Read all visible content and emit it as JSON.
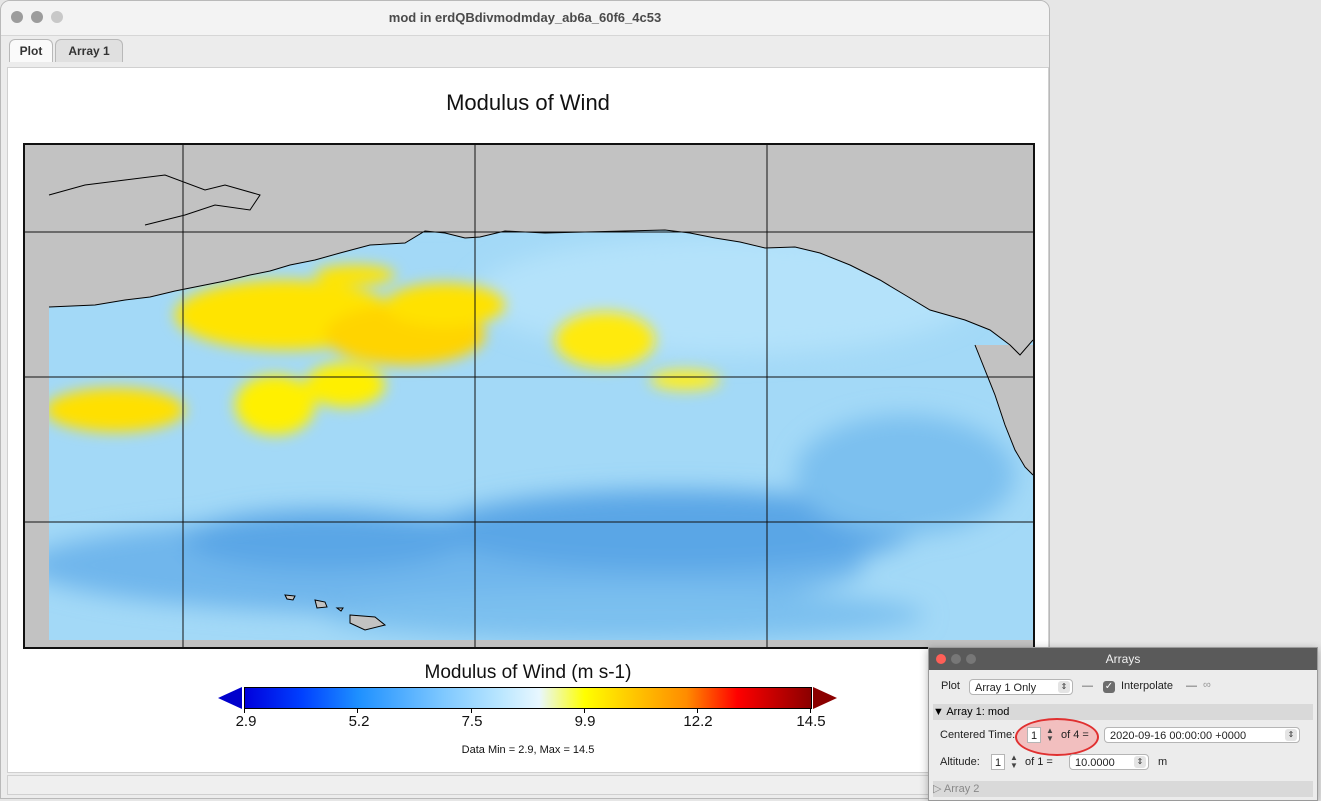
{
  "window": {
    "title": "mod in erdQBdivmodmday_ab6a_60f6_4c53"
  },
  "tabs": [
    {
      "label": "Plot",
      "active": true
    },
    {
      "label": "Array 1",
      "active": false
    }
  ],
  "plot": {
    "title": "Modulus of Wind",
    "colorbar": {
      "title": "Modulus of Wind (m s-1)",
      "ticks": [
        "2.9",
        "5.2",
        "7.5",
        "9.9",
        "12.2",
        "14.5"
      ],
      "min_color": "#0000cc",
      "max_color": "#8b0000"
    },
    "data_range": "Data Min = 2.9, Max = 14.5"
  },
  "arrays_panel": {
    "title": "Arrays",
    "plot_label": "Plot",
    "plot_select": "Array 1 Only",
    "interpolate_label": "Interpolate",
    "interpolate_checked": true,
    "array1_header": "Array 1: mod",
    "centered_time_label": "Centered Time:",
    "centered_time_index": "1",
    "centered_time_of": "of 4 =",
    "centered_time_value": "2020-09-16 00:00:00 +0000",
    "altitude_label": "Altitude:",
    "altitude_index": "1",
    "altitude_of": "of 1 =",
    "altitude_value": "10.0000",
    "altitude_unit": "m",
    "array2_header": "Array 2"
  },
  "icons": [
    "chevron-updown-icon",
    "check-icon",
    "disclosure-triangle-down-icon",
    "disclosure-triangle-right-icon",
    "link-icon"
  ]
}
